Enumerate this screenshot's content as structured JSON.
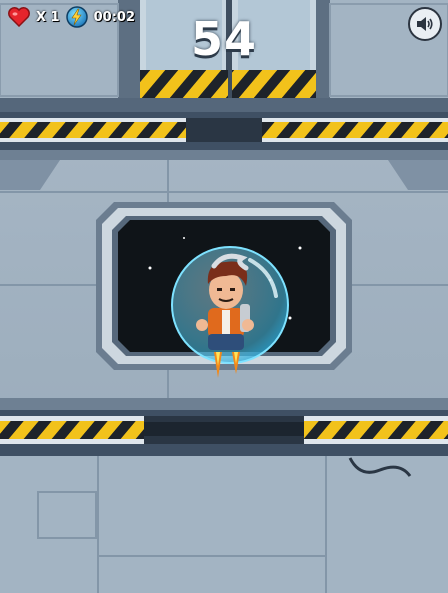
{
  "hud": {
    "lives_label": "X 1",
    "timer": "00:02",
    "score": "54"
  },
  "icons": {
    "lives": "heart-icon",
    "powerup": "lightning-orb-icon",
    "sound": "speaker-icon"
  },
  "colors": {
    "wall": "#a3b4c3",
    "panel_dark": "#56667a",
    "hazard_yellow": "#f2c21b",
    "space": "#0f1418",
    "bubble": "#5bd0ef",
    "heart": "#e5252c"
  }
}
